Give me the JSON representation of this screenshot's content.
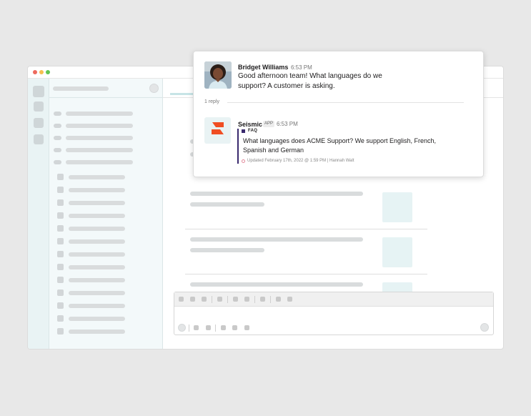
{
  "thread": {
    "parent": {
      "author": "Bridget Williams",
      "time": "6:53 PM",
      "text_line1": "Good afternoon team! What languages do we",
      "text_line2": "support? A customer is asking."
    },
    "reply_count": "1 reply",
    "reply": {
      "author": "Seismic",
      "badge": "APP",
      "time": "6:53 PM",
      "card_label": "FAQ",
      "card_text": "What languages does ACME Support? We support English, French, Spanish and German",
      "updated": "Updated February 17th, 2022 @ 1:59 PM | Hannah Walt"
    }
  },
  "colors": {
    "seismic_orange": "#f04e23",
    "faq_accent": "#3a2a6e",
    "sidebar_bg": "#f3f9fa",
    "rail_bg": "#e9f3f4"
  },
  "icons": {
    "avatar": "user-avatar",
    "seismic": "seismic-logo-icon",
    "faq": "faq-square-icon",
    "updated": "clock-icon"
  }
}
